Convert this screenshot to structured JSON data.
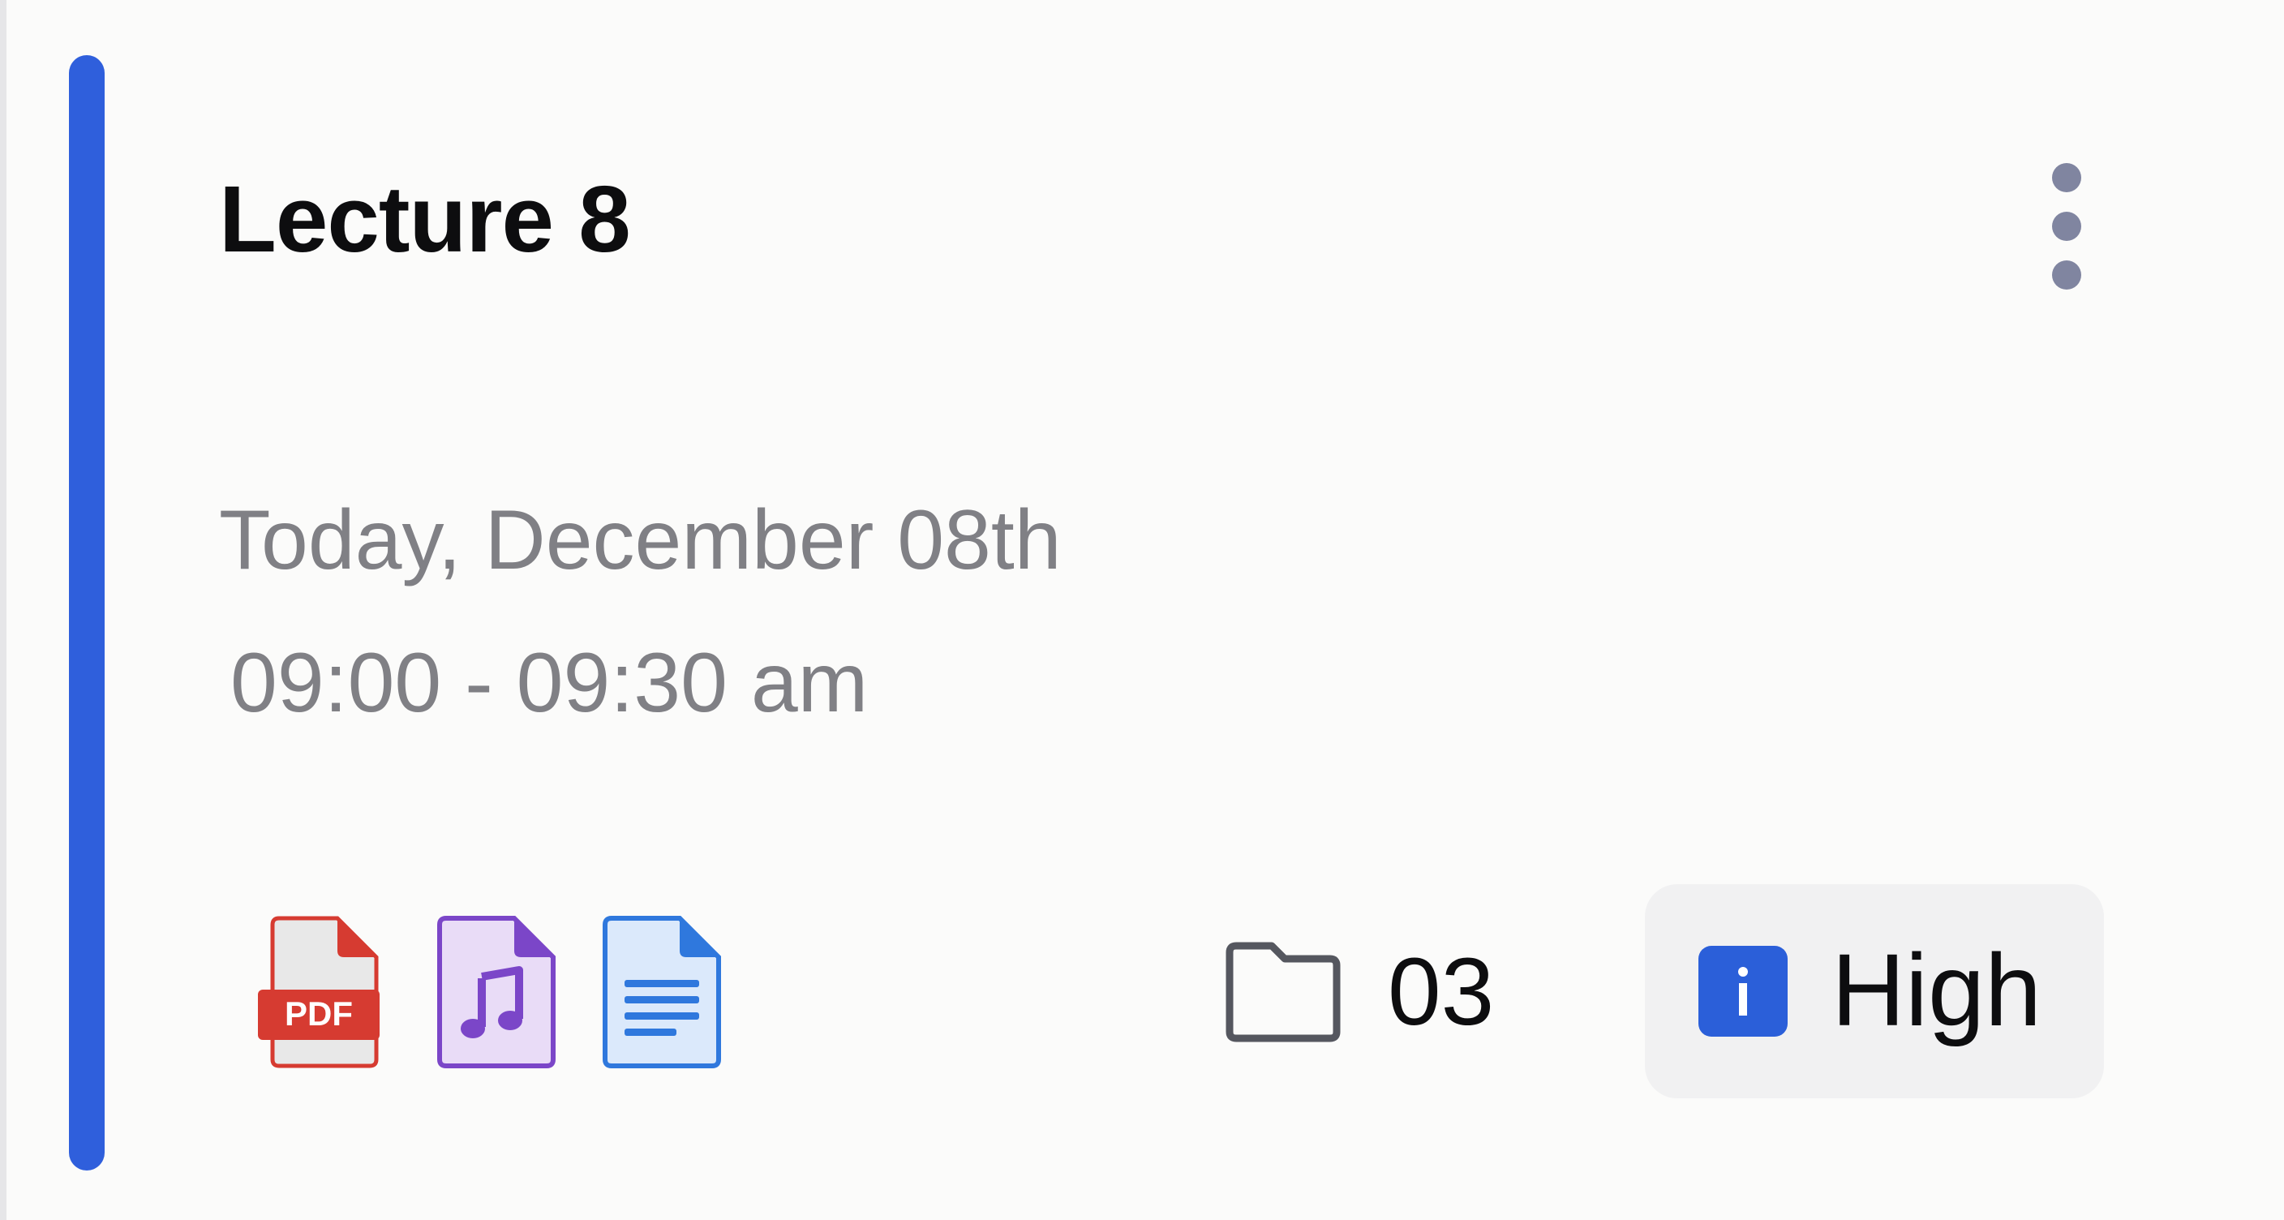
{
  "card": {
    "title": "Lecture 8",
    "date": "Today, December 08th",
    "time": "09:00 - 09:30 am",
    "accent_color": "#2f5fdc",
    "attachments": [
      {
        "type": "pdf",
        "icon": "pdf-file-icon",
        "label": "PDF",
        "color": "#d63b31"
      },
      {
        "type": "audio",
        "icon": "audio-file-icon",
        "color": "#7b46c8"
      },
      {
        "type": "document",
        "icon": "document-file-icon",
        "color": "#2f78dd"
      }
    ],
    "folder": {
      "icon": "folder-icon",
      "count": "03"
    },
    "priority": {
      "icon": "info-icon",
      "label": "High",
      "color": "#2b5fd9"
    },
    "menu_icon": "more-vertical-icon"
  }
}
